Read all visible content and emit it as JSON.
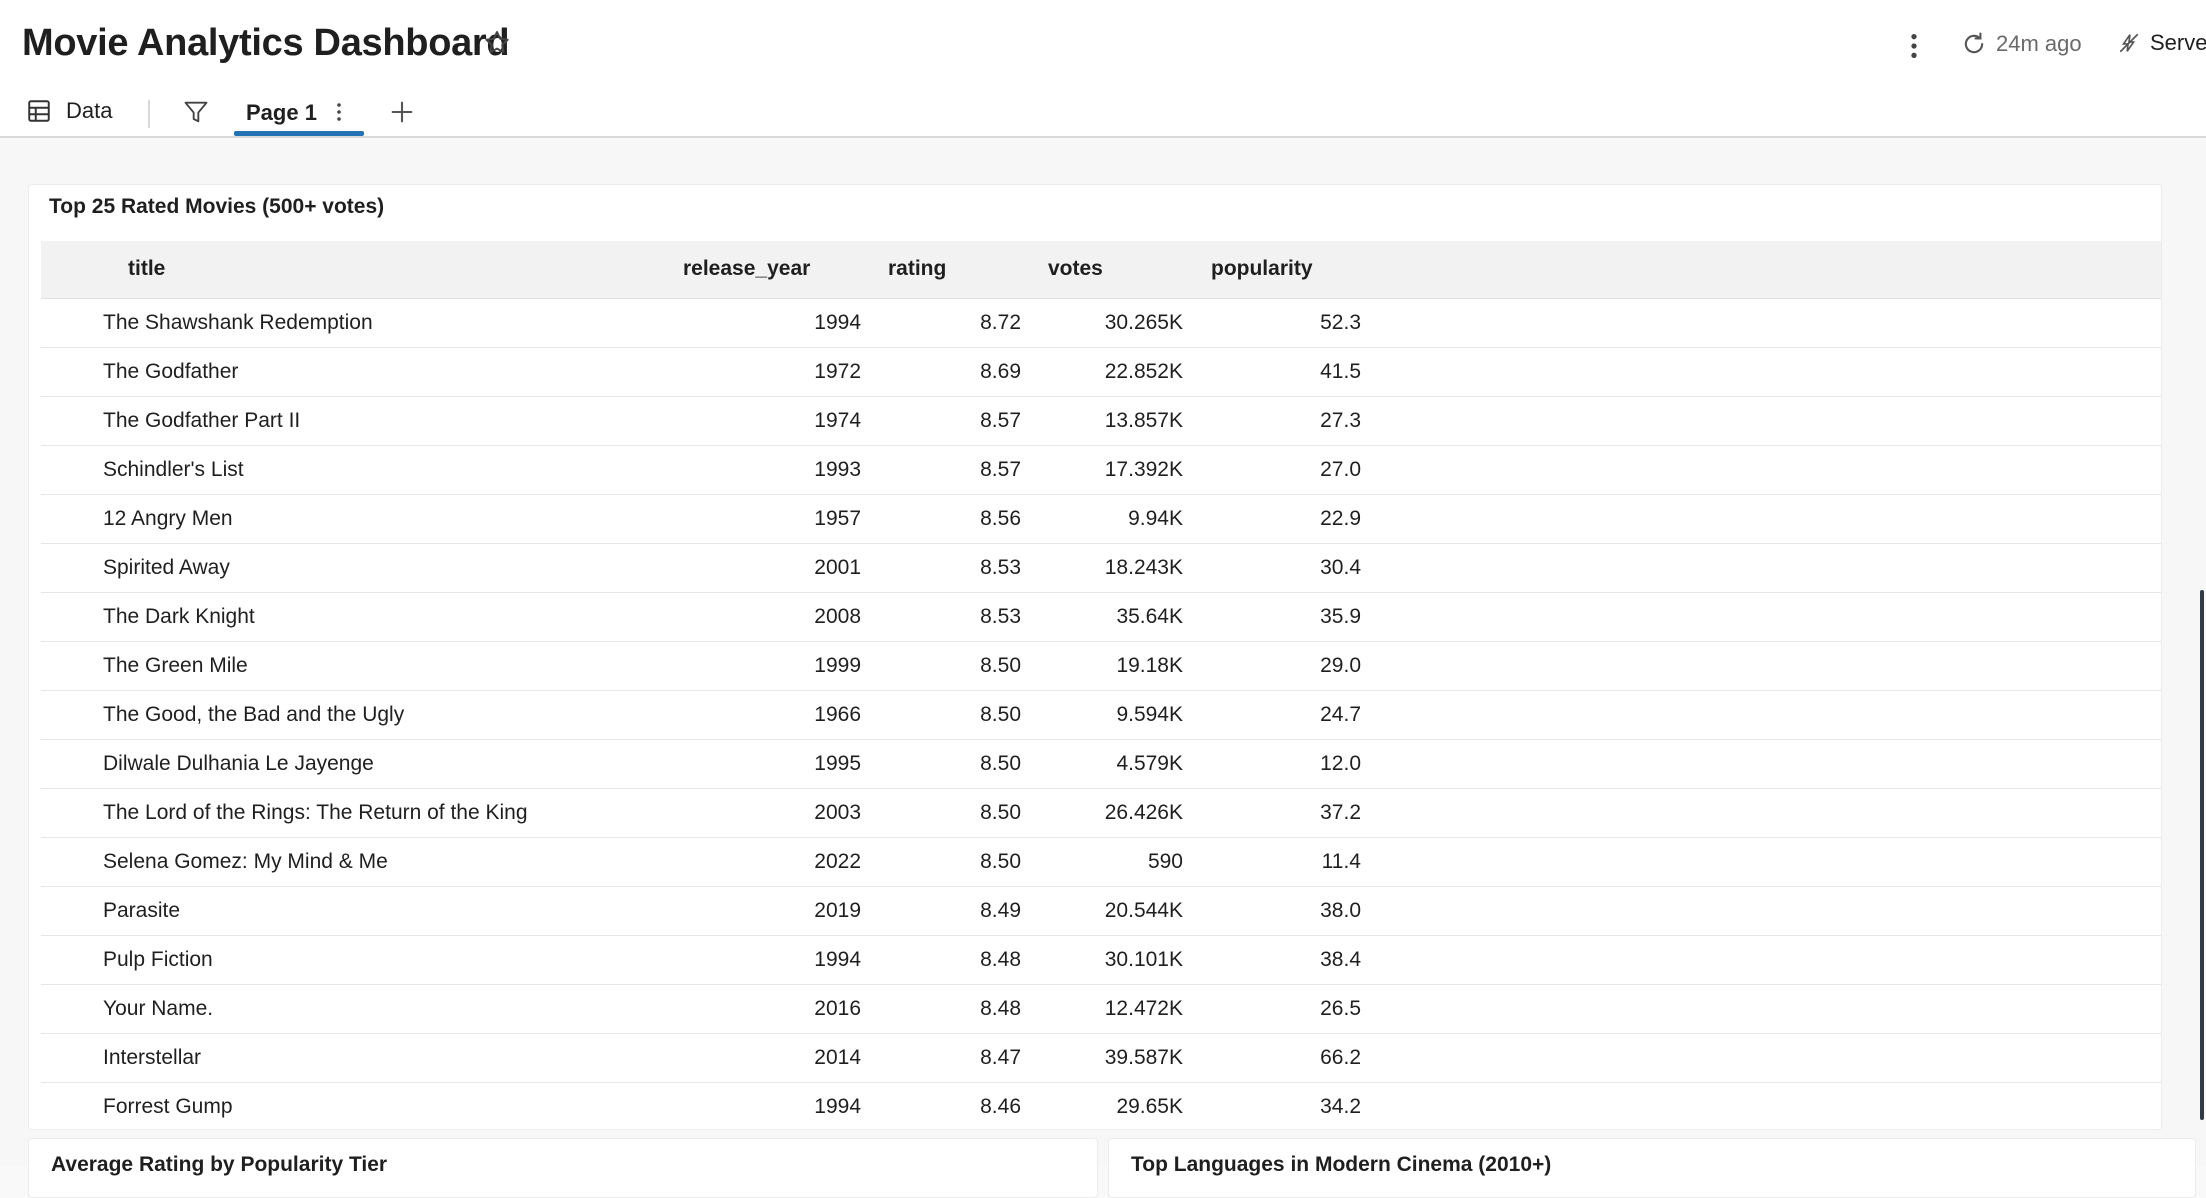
{
  "header": {
    "title": "Movie Analytics Dashboard",
    "refresh_label": "24m ago",
    "server_label": "Serve"
  },
  "tabs": {
    "data_label": "Data",
    "page_label": "Page 1"
  },
  "main_card": {
    "title": "Top 25 Rated Movies (500+ votes)",
    "columns": [
      "title",
      "release_year",
      "rating",
      "votes",
      "popularity"
    ],
    "rows": [
      [
        "The Shawshank Redemption",
        "1994",
        "8.72",
        "30.265K",
        "52.3"
      ],
      [
        "The Godfather",
        "1972",
        "8.69",
        "22.852K",
        "41.5"
      ],
      [
        "The Godfather Part II",
        "1974",
        "8.57",
        "13.857K",
        "27.3"
      ],
      [
        "Schindler's List",
        "1993",
        "8.57",
        "17.392K",
        "27.0"
      ],
      [
        "12 Angry Men",
        "1957",
        "8.56",
        "9.94K",
        "22.9"
      ],
      [
        "Spirited Away",
        "2001",
        "8.53",
        "18.243K",
        "30.4"
      ],
      [
        "The Dark Knight",
        "2008",
        "8.53",
        "35.64K",
        "35.9"
      ],
      [
        "The Green Mile",
        "1999",
        "8.50",
        "19.18K",
        "29.0"
      ],
      [
        "The Good, the Bad and the Ugly",
        "1966",
        "8.50",
        "9.594K",
        "24.7"
      ],
      [
        "Dilwale Dulhania Le Jayenge",
        "1995",
        "8.50",
        "4.579K",
        "12.0"
      ],
      [
        "The Lord of the Rings: The Return of the King",
        "2003",
        "8.50",
        "26.426K",
        "37.2"
      ],
      [
        "Selena Gomez: My Mind & Me",
        "2022",
        "8.50",
        "590",
        "11.4"
      ],
      [
        "Parasite",
        "2019",
        "8.49",
        "20.544K",
        "38.0"
      ],
      [
        "Pulp Fiction",
        "1994",
        "8.48",
        "30.101K",
        "38.4"
      ],
      [
        "Your Name.",
        "2016",
        "8.48",
        "12.472K",
        "26.5"
      ],
      [
        "Interstellar",
        "2014",
        "8.47",
        "39.587K",
        "66.2"
      ],
      [
        "Forrest Gump",
        "1994",
        "8.46",
        "29.65K",
        "34.2"
      ]
    ]
  },
  "bottom_cards": {
    "left_title": "Average Rating by Popularity Tier",
    "right_title": "Top Languages in Modern Cinema (2010+)"
  },
  "colors": {
    "accent": "#2272b4",
    "text": "#1f1f1f",
    "muted": "#6a6a6a"
  },
  "icons": {
    "star": "star-icon",
    "kebab": "kebab-icon",
    "refresh": "refresh-icon",
    "server": "server-off-icon",
    "data": "table-icon",
    "filter": "filter-icon",
    "add": "plus-icon"
  }
}
